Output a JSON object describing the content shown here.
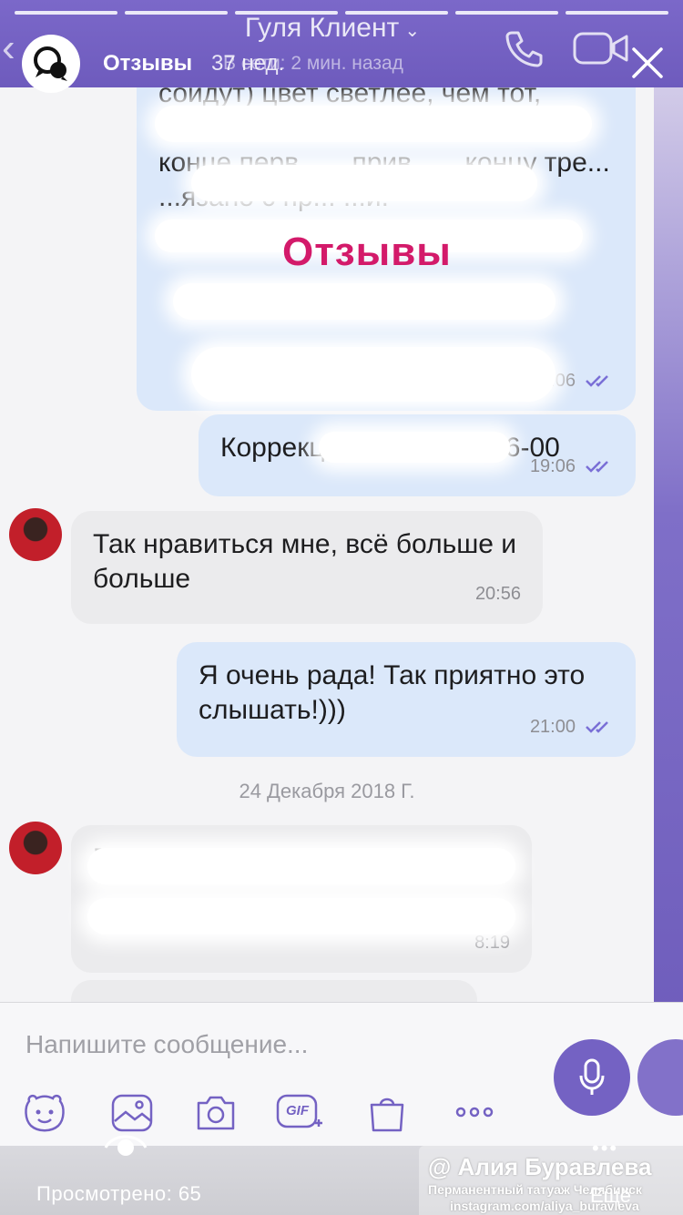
{
  "story": {
    "account_name": "Отзывы",
    "posted_ago": "37 нед.",
    "views_label": "Просмотрено: 65",
    "more_label": "Ещё",
    "more_dots": "•••",
    "progress_segments": 6,
    "progress_filled": 6
  },
  "viber": {
    "contact_name": "Гуля Клиент",
    "contact_chevron": "⌄",
    "last_seen": "В сети: 2 мин. назад",
    "back_glyph": "‹",
    "icons": [
      "phone-icon",
      "video-call-icon"
    ]
  },
  "overlay": {
    "stamp_text": "Отзывы"
  },
  "messages": [
    {
      "direction": "out",
      "text": "сойдут) цвет светлее, чем тот, кото... ...оцедуры цв... ...чем в конце перв... ...прив... ...концу тре... ...язано с пр... ...и.",
      "time": "19:06",
      "read": true
    },
    {
      "direction": "out",
      "text": "Коррекция ... ...аря в 16-00",
      "time": "19:06",
      "read": true
    },
    {
      "direction": "in",
      "text": "Так нравиться мне, всё больше и больше",
      "time": "20:56"
    },
    {
      "direction": "out",
      "text": "Я очень рада! Так приятно это слышать!)))",
      "time": "21:00",
      "read": true
    },
    {
      "direction": "in",
      "text": "Приве... ...на корр...",
      "time": "8:19"
    }
  ],
  "date_separator": "24 Декабря 2018 Г.",
  "composer": {
    "placeholder": "Напишите сообщение...",
    "tools": [
      "sticker-icon",
      "gallery-icon",
      "camera-icon",
      "gif-icon",
      "shopping-bag-icon",
      "more-icon"
    ],
    "gif_label": "GIF"
  },
  "watermark": {
    "name": "@ Алия Буравлева",
    "subtitle": "Перманентный татуаж Челябинск",
    "instagram": "instagram.com/aliya_buravleva"
  },
  "colors": {
    "viber_purple": "#7462c3",
    "outgoing_bubble": "#dbe8fa",
    "incoming_bubble": "#ebebed",
    "stamp_pink": "#d31a6a",
    "read_ticks": "#7a6fd6"
  }
}
